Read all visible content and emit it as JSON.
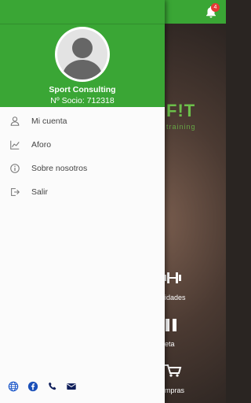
{
  "background_app": {
    "brand_text": "F!T",
    "brand_subtitle": "training",
    "notification_count": "4",
    "tiles": [
      {
        "label": "idades",
        "icon": "dumbbell-icon"
      },
      {
        "label": "eta",
        "icon": "card-icon"
      },
      {
        "label": "mpras",
        "icon": "cart-icon"
      }
    ]
  },
  "drawer": {
    "header_color": "#3aa635",
    "user": {
      "name": "Sport Consulting",
      "socio": "Nº Socio: 712318"
    },
    "menu": [
      {
        "label": "Mi cuenta",
        "icon": "person-icon"
      },
      {
        "label": "Aforo",
        "icon": "chart-icon"
      },
      {
        "label": "Sobre nosotros",
        "icon": "info-icon"
      },
      {
        "label": "Salir",
        "icon": "logout-icon"
      }
    ],
    "footer_icons": [
      "globe-icon",
      "facebook-icon",
      "phone-icon",
      "mail-icon"
    ]
  }
}
